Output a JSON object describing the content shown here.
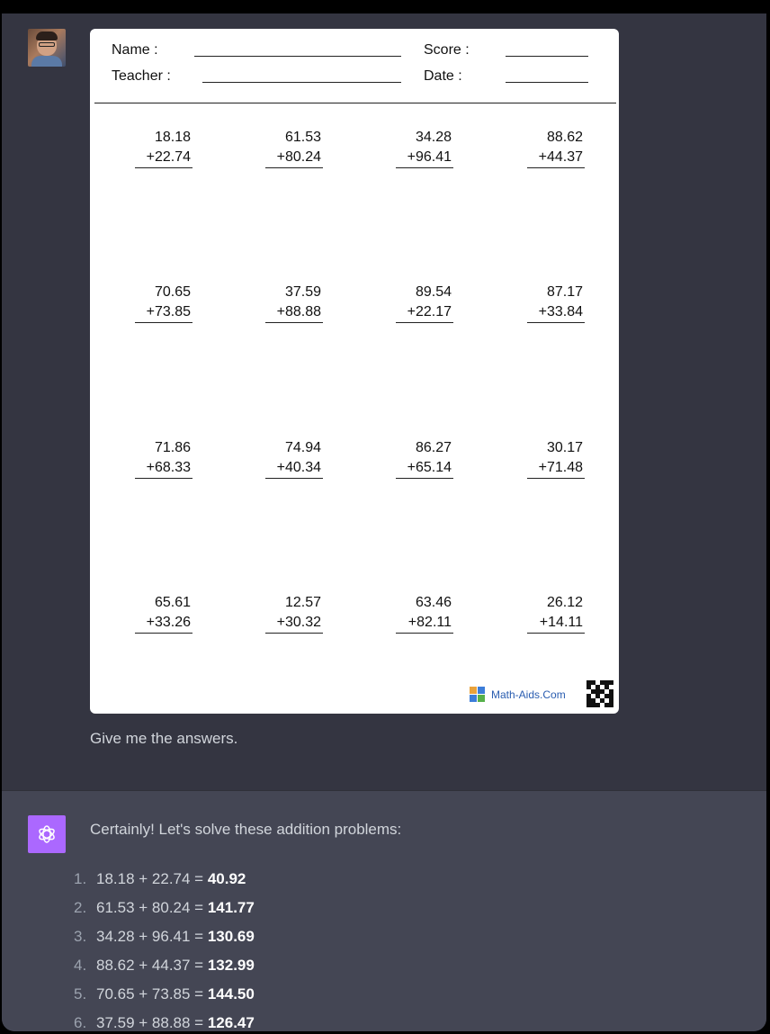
{
  "worksheet": {
    "name_label": "Name :",
    "teacher_label": "Teacher :",
    "score_label": "Score :",
    "date_label": "Date :",
    "problems": [
      {
        "a": "18.18",
        "b": "+22.74"
      },
      {
        "a": "61.53",
        "b": "+80.24"
      },
      {
        "a": "34.28",
        "b": "+96.41"
      },
      {
        "a": "88.62",
        "b": "+44.37"
      },
      {
        "a": "70.65",
        "b": "+73.85"
      },
      {
        "a": "37.59",
        "b": "+88.88"
      },
      {
        "a": "89.54",
        "b": "+22.17"
      },
      {
        "a": "87.17",
        "b": "+33.84"
      },
      {
        "a": "71.86",
        "b": "+68.33"
      },
      {
        "a": "74.94",
        "b": "+40.34"
      },
      {
        "a": "86.27",
        "b": "+65.14"
      },
      {
        "a": "30.17",
        "b": "+71.48"
      },
      {
        "a": "65.61",
        "b": "+33.26"
      },
      {
        "a": "12.57",
        "b": "+30.32"
      },
      {
        "a": "63.46",
        "b": "+82.11"
      },
      {
        "a": "26.12",
        "b": "+14.11"
      }
    ],
    "brand": "Math-Aids.Com"
  },
  "user_message": "Give me the answers.",
  "assistant": {
    "intro": "Certainly! Let's solve these addition problems:",
    "answers": [
      {
        "num": "1.",
        "expr": "18.18 + 22.74 = ",
        "result": "40.92"
      },
      {
        "num": "2.",
        "expr": "61.53 + 80.24 = ",
        "result": "141.77"
      },
      {
        "num": "3.",
        "expr": "34.28 + 96.41 = ",
        "result": "130.69"
      },
      {
        "num": "4.",
        "expr": "88.62 + 44.37 = ",
        "result": "132.99"
      },
      {
        "num": "5.",
        "expr": "70.65 + 73.85 = ",
        "result": "144.50"
      },
      {
        "num": "6.",
        "expr": "37.59 + 88.88 = ",
        "result": "126.47"
      }
    ]
  },
  "colors": {
    "user_bg": "#343541",
    "assistant_bg": "#444654",
    "gpt_icon_bg": "#ab68ff",
    "brand_link": "#2a5db0"
  },
  "icons": {
    "user_avatar": "avatar-photo",
    "assistant": "openai-logo-icon",
    "worksheet_brand": "math-aids-logo-icon",
    "qr": "qr-code-icon"
  }
}
